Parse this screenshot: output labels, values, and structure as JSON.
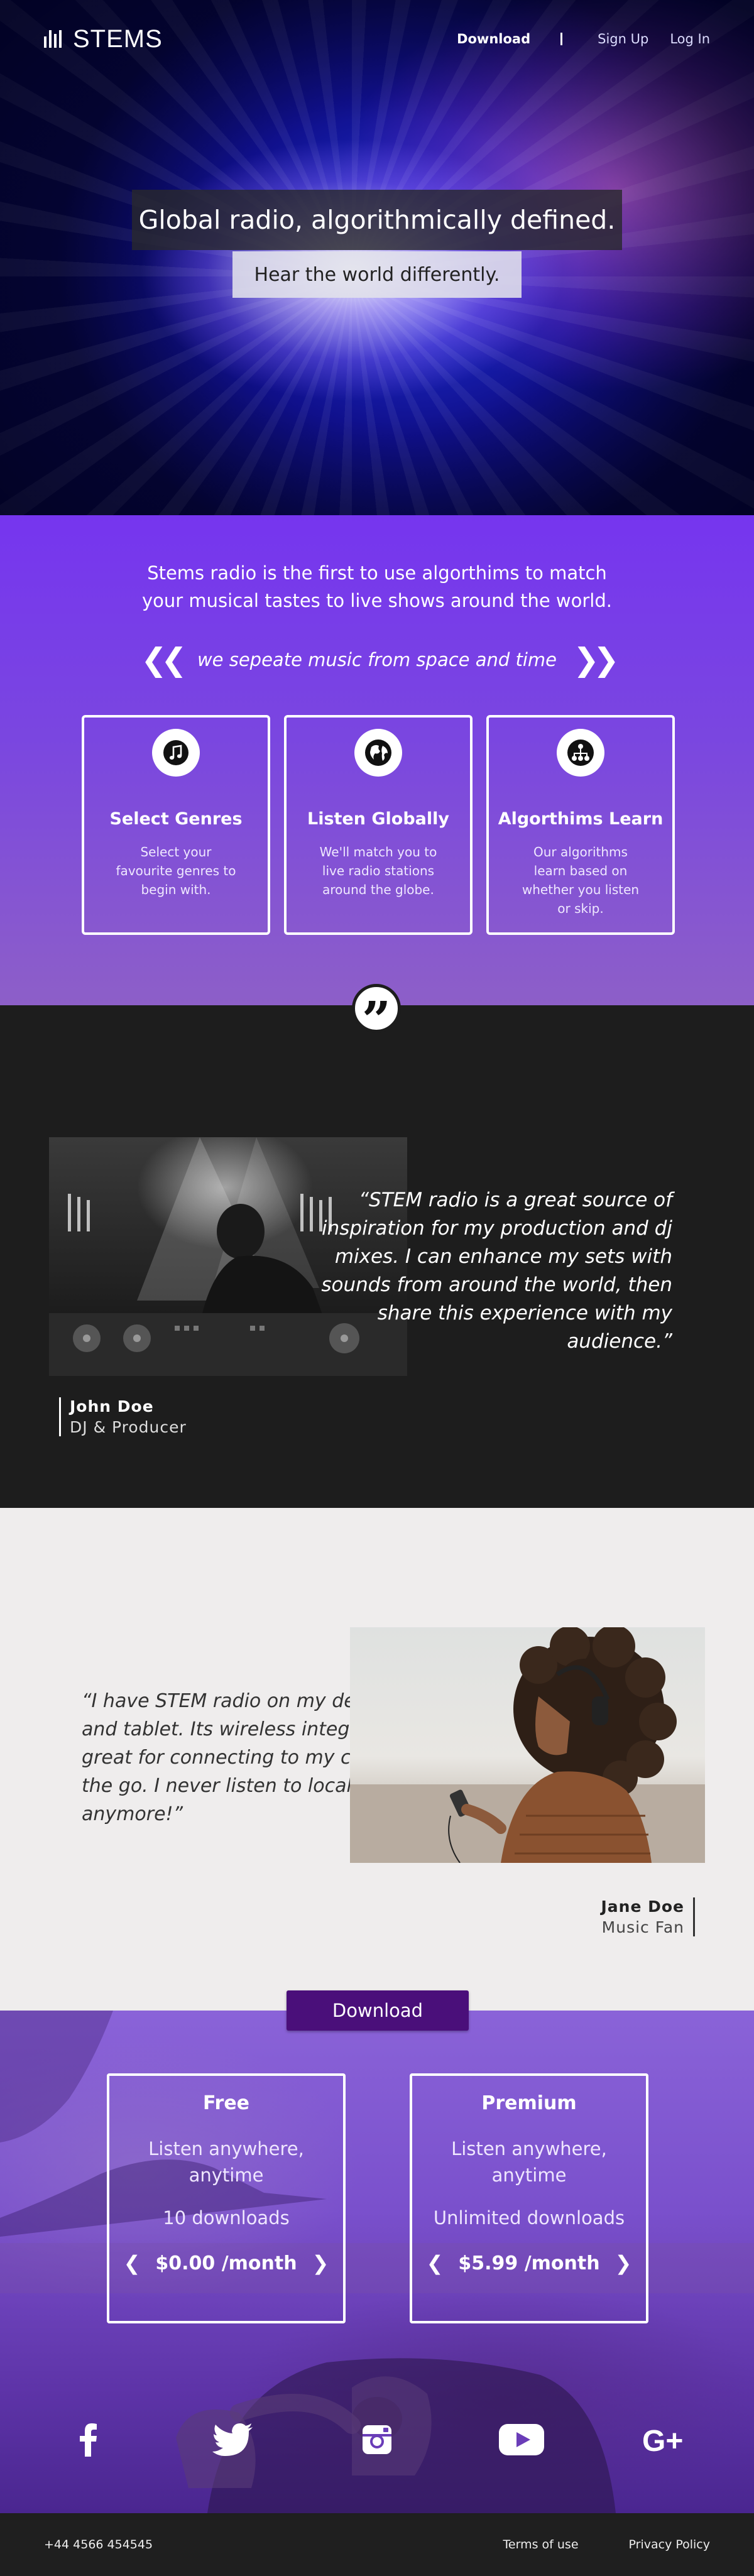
{
  "nav": {
    "brand": "STEMS",
    "download": "Download",
    "signup": "Sign Up",
    "login": "Log In"
  },
  "hero": {
    "title": "Global radio, algorithmically defined.",
    "subtitle": "Hear the world differently."
  },
  "features": {
    "intro_line1": "Stems radio is the first to use algorthims to match",
    "intro_line2": "your musical tastes to live shows around the world.",
    "tagline": "we sepeate music from space and time",
    "cards": [
      {
        "icon": "music-note-icon",
        "title": "Select Genres",
        "text": "Select your favourite genres to begin with."
      },
      {
        "icon": "globe-icon",
        "title": "Listen Globally",
        "text": "We'll match you to live radio stations around the globe."
      },
      {
        "icon": "network-icon",
        "title": "Algorthims Learn",
        "text": "Our algorithms learn based on whether you listen or skip."
      }
    ]
  },
  "testimonials": [
    {
      "quote": "“STEM radio is a great source of inspiration for my production and dj mixes. I can enhance my sets with sounds from around the world, then share this experience with my audience.”",
      "name": "John Doe",
      "role": "DJ & Producer"
    },
    {
      "quote": "“I have STEM radio on my desktop, mobile and tablet. Its wireless integreation is great for connecting to my car radio on the go. I never listen to local radio anymore!”",
      "name": "Jane Doe",
      "role": "Music Fan"
    }
  ],
  "pricing": {
    "cta": "Download",
    "plans": [
      {
        "name": "Free",
        "feature": "Listen anywhere, anytime",
        "downloads": "10 downloads",
        "price": "$0.00 /month"
      },
      {
        "name": "Premium",
        "feature": "Listen anywhere, anytime",
        "downloads": "Unlimited downloads",
        "price": "$5.99 /month"
      }
    ],
    "socials": [
      "facebook-icon",
      "twitter-icon",
      "instagram-icon",
      "youtube-icon",
      "google-plus-icon"
    ]
  },
  "footer": {
    "phone": "+44 4566 454545",
    "terms": "Terms of use",
    "privacy": "Privacy Policy"
  },
  "colors": {
    "purple": "#7635ef",
    "cta": "#4a0f7a",
    "dark": "#1d1d1d",
    "light": "#efeded"
  }
}
